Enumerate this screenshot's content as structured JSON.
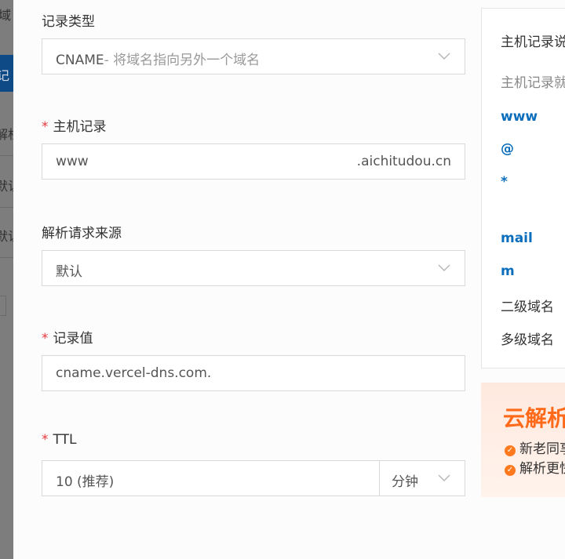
{
  "background": {
    "fragments": [
      "域",
      "记",
      "解析",
      "默认",
      "默认"
    ]
  },
  "form": {
    "record_type": {
      "label": "记录类型",
      "value_main": "CNAME",
      "value_hint": "- 将域名指向另外一个域名"
    },
    "host": {
      "label": "主机记录",
      "value": "www",
      "suffix": ".aichitudou.cn"
    },
    "source": {
      "label": "解析请求来源",
      "value": "默认"
    },
    "record_value": {
      "label": "记录值",
      "value": "cname.vercel-dns.com."
    },
    "ttl": {
      "label": "TTL",
      "value": "10 (推荐)",
      "unit": "分钟"
    },
    "required_mark": "*"
  },
  "help": {
    "title": "主机记录说",
    "subtitle": "主机记录就",
    "keys": [
      "www",
      "@",
      "*",
      "mail",
      "m"
    ],
    "desc": [
      "二级域名",
      "多级域名"
    ]
  },
  "promo": {
    "title": "云解析",
    "items": [
      "新老同享",
      "解析更快"
    ],
    "accent": "#ff6a1a"
  },
  "colors": {
    "link_blue": "#0a6ebd",
    "required_red": "#e4393c",
    "border": "#d9d9d9"
  }
}
